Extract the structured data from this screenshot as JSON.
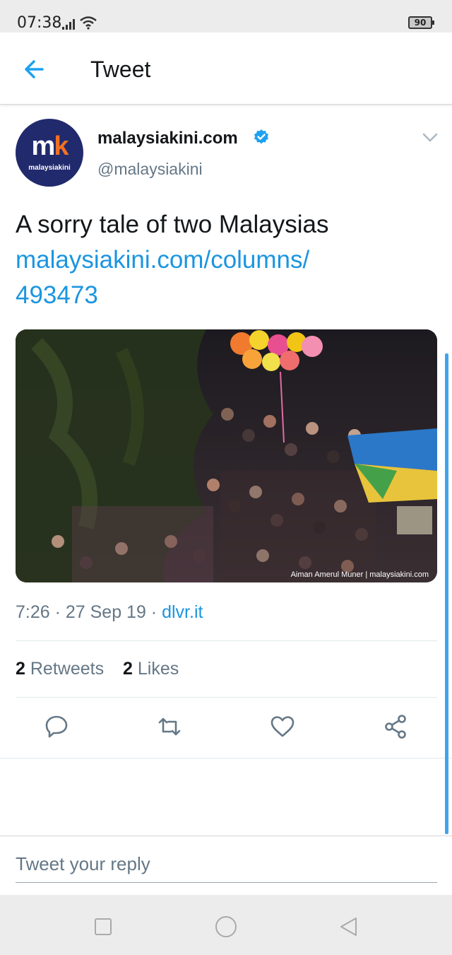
{
  "status_bar": {
    "time": "07:38",
    "battery": "90"
  },
  "header": {
    "title": "Tweet"
  },
  "tweet": {
    "display_name": "malaysiakini.com",
    "handle": "@malaysiakini",
    "avatar_mark": "mk",
    "avatar_caption": "malaysiakini",
    "text": "A sorry tale of two Malaysias",
    "link_line1": "malaysiakini.com/columns/",
    "link_line2": "493473",
    "photo_credit": "Aiman Amerul Muner | malaysiakini.com",
    "time": "7:26 · 27 Sep 19 · ",
    "source": "dlvr.it",
    "retweets_count": "2",
    "retweets_label": "Retweets",
    "likes_count": "2",
    "likes_label": "Likes"
  },
  "reply": {
    "placeholder": "Tweet your reply"
  },
  "colors": {
    "accent": "#1b95e0",
    "avatar_bg": "#212a6c"
  },
  "icons": [
    "signal-icon",
    "wifi-icon",
    "back-arrow-icon",
    "verified-icon",
    "chevron-down-icon",
    "reply-icon",
    "retweet-icon",
    "like-icon",
    "share-icon",
    "nav-square-icon",
    "nav-circle-icon",
    "nav-back-icon"
  ]
}
